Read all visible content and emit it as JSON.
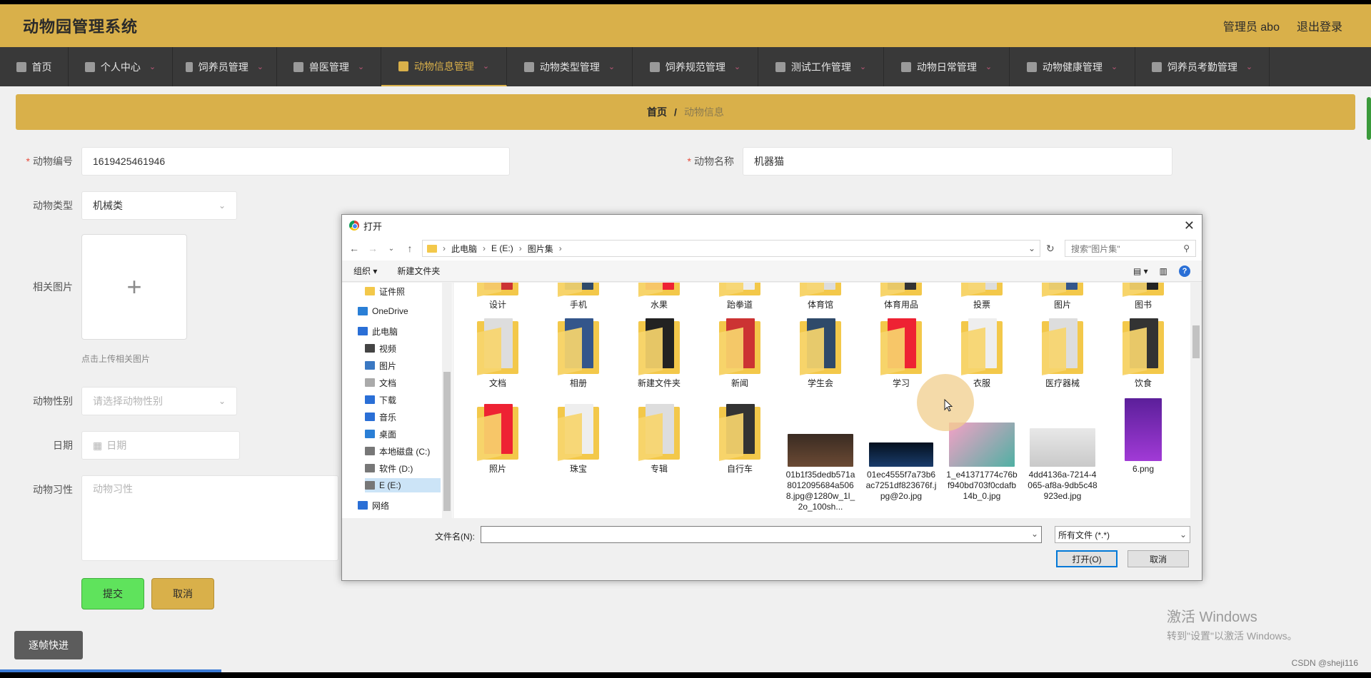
{
  "header": {
    "title": "动物园管理系统",
    "admin": "管理员 abo",
    "logout": "退出登录"
  },
  "nav": [
    {
      "label": "首页",
      "icon": "home-icon"
    },
    {
      "label": "个人中心",
      "icon": "user-icon"
    },
    {
      "label": "饲养员管理",
      "icon": "list-icon"
    },
    {
      "label": "兽医管理",
      "icon": "grid-icon"
    },
    {
      "label": "动物信息管理",
      "icon": "clipboard-icon",
      "active": true
    },
    {
      "label": "动物类型管理",
      "icon": "stamp-icon"
    },
    {
      "label": "饲养规范管理",
      "icon": "clock-icon"
    },
    {
      "label": "测试工作管理",
      "icon": "compass-icon"
    },
    {
      "label": "动物日常管理",
      "icon": "user-icon"
    },
    {
      "label": "动物健康管理",
      "icon": "mic-icon"
    },
    {
      "label": "饲养员考勤管理",
      "icon": "ticket-icon"
    }
  ],
  "breadcrumb": {
    "home": "首页",
    "sep": "/",
    "current": "动物信息"
  },
  "form": {
    "animal_no_label": "动物编号",
    "animal_no": "1619425461946",
    "animal_name_label": "动物名称",
    "animal_name": "机器猫",
    "type_label": "动物类型",
    "type_value": "机械类",
    "image_label": "相关图片",
    "upload_plus": "+",
    "upload_hint": "点击上传相关图片",
    "gender_label": "动物性别",
    "gender_placeholder": "请选择动物性别",
    "date_label": "日期",
    "date_placeholder": "日期",
    "habit_label": "动物习性",
    "habit_placeholder": "动物习性",
    "submit": "提交",
    "cancel": "取消"
  },
  "frame_step": "逐帧快进",
  "activate": {
    "line1": "激活 Windows",
    "line2": "转到\"设置\"以激活 Windows。"
  },
  "watermark": "CSDN @sheji116",
  "dialog": {
    "title": "打开",
    "path": [
      "此电脑",
      "E (E:)",
      "图片集"
    ],
    "search_placeholder": "搜索\"图片集\"",
    "organize": "组织 ▾",
    "new_folder": "新建文件夹",
    "tree": [
      {
        "label": "证件照",
        "icon": "folder-icon"
      },
      {
        "label": "OneDrive",
        "icon": "cloud-icon"
      },
      {
        "label": "此电脑",
        "icon": "computer-icon"
      },
      {
        "label": "视频",
        "icon": "video-icon"
      },
      {
        "label": "图片",
        "icon": "image-icon"
      },
      {
        "label": "文档",
        "icon": "document-icon"
      },
      {
        "label": "下载",
        "icon": "download-icon"
      },
      {
        "label": "音乐",
        "icon": "music-icon"
      },
      {
        "label": "桌面",
        "icon": "desktop-icon"
      },
      {
        "label": "本地磁盘 (C:)",
        "icon": "drive-icon"
      },
      {
        "label": "软件 (D:)",
        "icon": "drive-icon"
      },
      {
        "label": "E (E:)",
        "icon": "drive-icon",
        "selected": true
      },
      {
        "label": "网络",
        "icon": "network-icon"
      }
    ],
    "row1": [
      "设计",
      "手机",
      "水果",
      "跆拳道",
      "体育馆",
      "体育用品",
      "投票",
      "图片",
      "图书"
    ],
    "row2": [
      "文档",
      "相册",
      "新建文件夹",
      "新闻",
      "学生会",
      "学习",
      "衣服",
      "医疗器械",
      "饮食"
    ],
    "row3": [
      {
        "name": "照片",
        "kind": "folder"
      },
      {
        "name": "珠宝",
        "kind": "folder"
      },
      {
        "name": "专辑",
        "kind": "folder"
      },
      {
        "name": "自行车",
        "kind": "folder"
      },
      {
        "name": "01b1f35dedb571a8012095684a5068.jpg@1280w_1l_2o_100sh...",
        "kind": "image"
      },
      {
        "name": "01ec4555f7a73b6ac7251df823676f.jpg@2o.jpg",
        "kind": "image"
      },
      {
        "name": "1_e41371774c76bf940bd703f0cdafb14b_0.jpg",
        "kind": "image"
      },
      {
        "name": "4dd4136a-7214-4065-af8a-9db5c48923ed.jpg",
        "kind": "image"
      },
      {
        "name": "6.png",
        "kind": "image"
      }
    ],
    "filename_label": "文件名(N):",
    "filename_value": "",
    "filetype": "所有文件 (*.*)",
    "open": "打开(O)",
    "cancel": "取消"
  }
}
